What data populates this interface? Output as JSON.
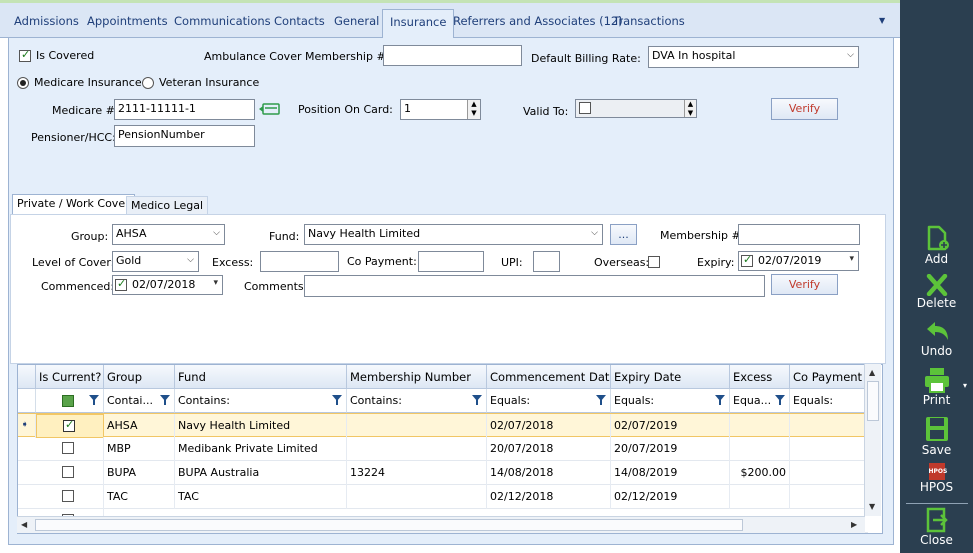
{
  "tabs": [
    "Admissions",
    "Appointments",
    "Communications",
    "Contacts",
    "General",
    "Insurance",
    "Referrers and Associates (12)",
    "Transactions"
  ],
  "active_tab": "Insurance",
  "insurance": {
    "is_covered_label": "Is Covered",
    "ambulance_label": "Ambulance Cover Membership #:",
    "ambulance_value": "",
    "billing_rate_label": "Default Billing Rate:",
    "billing_rate_value": "DVA In hospital",
    "medicare_radio": "Medicare Insurance",
    "veteran_radio": "Veteran Insurance",
    "medicare_label": "Medicare #:",
    "medicare_value": "2111-11111-1",
    "position_label": "Position On Card:",
    "position_value": "1",
    "valid_to_label": "Valid To:",
    "verify_label": "Verify",
    "pensioner_label": "Pensioner/HCC:",
    "pensioner_value": "PensionNumber"
  },
  "inner_tabs": [
    "Private / Work Cover",
    "Medico Legal"
  ],
  "private": {
    "group_label": "Group:",
    "group_value": "AHSA",
    "fund_label": "Fund:",
    "fund_value": "Navy Health Limited",
    "ellipsis": "...",
    "membership_label": "Membership #:",
    "membership_value": "",
    "level_label": "Level of Cover:",
    "level_value": "Gold",
    "excess_label": "Excess:",
    "copayment_label": "Co Payment:",
    "upi_label": "UPI:",
    "overseas_label": "Overseas:",
    "expiry_label": "Expiry:",
    "expiry_value": "02/07/2019",
    "commenced_label": "Commenced:",
    "commenced_value": "02/07/2018",
    "comments_label": "Comments:",
    "verify_label": "Verify"
  },
  "grid": {
    "columns": [
      "Is Current?",
      "Group",
      "Fund",
      "Membership Number",
      "Commencement Date",
      "Expiry Date",
      "Excess",
      "Co Payment"
    ],
    "filters": [
      "",
      "Contai...",
      "Contains:",
      "Contains:",
      "Equals:",
      "Equals:",
      "Equa...",
      "Equals:"
    ],
    "rows": [
      {
        "current": true,
        "group": "AHSA",
        "fund": "Navy Health Limited",
        "membership": "",
        "commenced": "02/07/2018",
        "expiry": "02/07/2019",
        "excess": ""
      },
      {
        "current": false,
        "group": "MBP",
        "fund": "Medibank Private Limited",
        "membership": "",
        "commenced": "20/07/2018",
        "expiry": "20/07/2019",
        "excess": ""
      },
      {
        "current": false,
        "group": "BUPA",
        "fund": "BUPA Australia",
        "membership": "13224",
        "commenced": "14/08/2018",
        "expiry": "14/08/2019",
        "excess": "$200.00"
      },
      {
        "current": false,
        "group": "TAC",
        "fund": "TAC",
        "membership": "",
        "commenced": "02/12/2018",
        "expiry": "02/12/2019",
        "excess": ""
      }
    ]
  },
  "sidebar": {
    "add": "Add",
    "delete": "Delete",
    "undo": "Undo",
    "print": "Print",
    "save": "Save",
    "hpos_icon_text": "HPOS",
    "hpos": "HPOS",
    "close": "Close"
  },
  "colors": {
    "sidebar_bg": "#2b3f50",
    "icon_green": "#5cc33a",
    "verify_text": "#c0392b"
  }
}
